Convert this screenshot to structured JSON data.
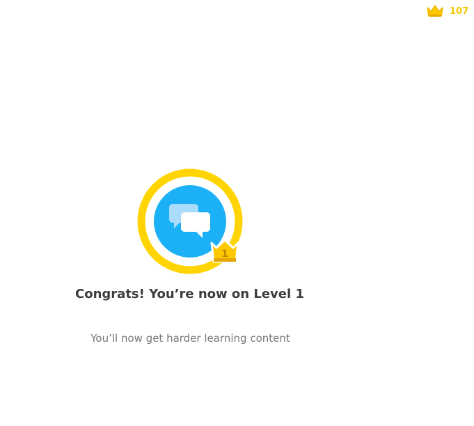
{
  "header": {
    "crown_icon": "crown-icon",
    "crown_count": "107"
  },
  "badge": {
    "icon": "chat-bubbles-icon",
    "level_crown_icon": "crown-icon",
    "level_number": "1"
  },
  "message": {
    "title": "Congrats! You’re now on Level 1",
    "subtitle": "You’ll now get harder learning content"
  },
  "colors": {
    "gold": "#ffd400",
    "crown": "#ffc800",
    "crown_shadow": "#e5a600",
    "blue": "#1cb0f6",
    "bubble_light": "#a8dcfa",
    "title_text": "#3c3c3c",
    "body_text": "#777777"
  }
}
